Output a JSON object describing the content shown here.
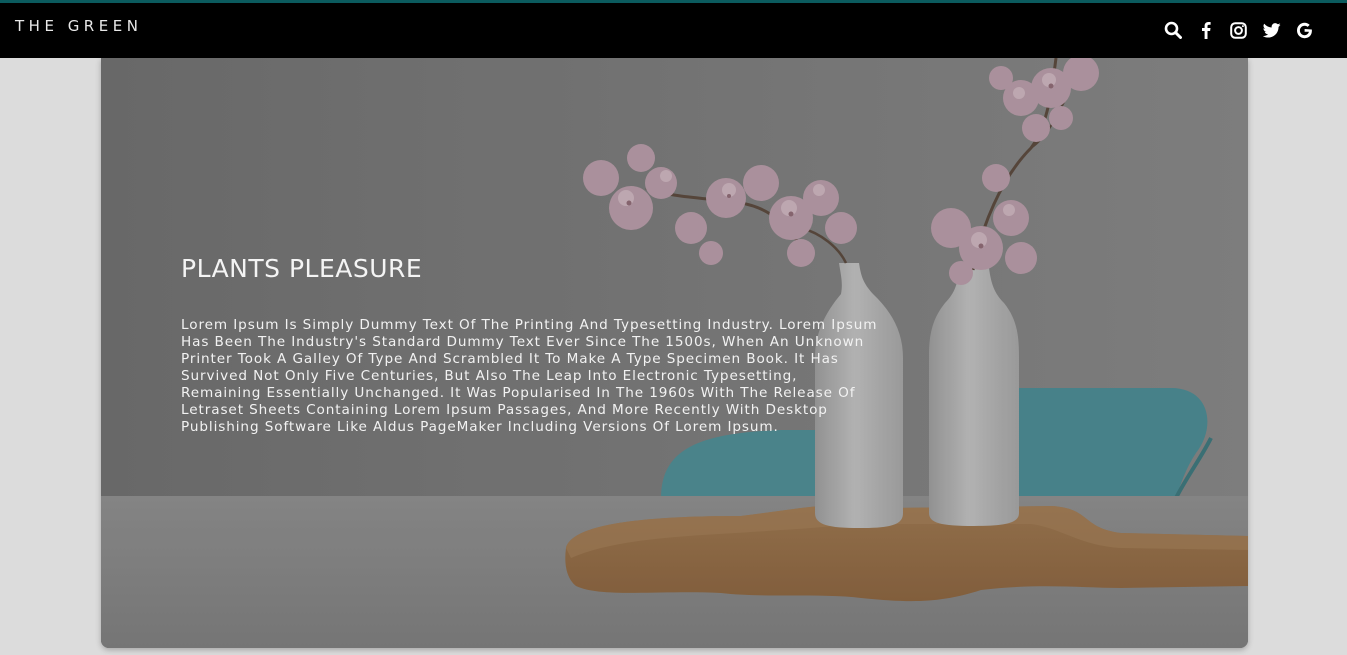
{
  "header": {
    "brand": "THE GREEN",
    "icons": [
      "search-icon",
      "facebook-icon",
      "instagram-icon",
      "twitter-icon",
      "google-icon"
    ]
  },
  "hero": {
    "title": "PLANTS PLEASURE",
    "body": "Lorem Ipsum Is Simply Dummy Text Of The Printing And Typesetting Industry. Lorem Ipsum Has Been The Industry's Standard Dummy Text Ever Since The 1500s, When An Unknown Printer Took A Galley Of Type And Scrambled It To Make A Type Specimen Book. It Has Survived Not Only Five Centuries, But Also The Leap Into Electronic Typesetting, Remaining Essentially Unchanged. It Was Popularised In The 1960s With The Release Of Letraset Sheets Containing Lorem Ipsum Passages, And More Recently With Desktop Publishing Software Like Aldus PageMaker Including Versions Of Lorem Ipsum."
  },
  "colors": {
    "topbar": "#000000",
    "topbar_accent": "#0b5b5e",
    "page_background": "#dcdcdc",
    "hero_text": "#f2f2f2"
  }
}
